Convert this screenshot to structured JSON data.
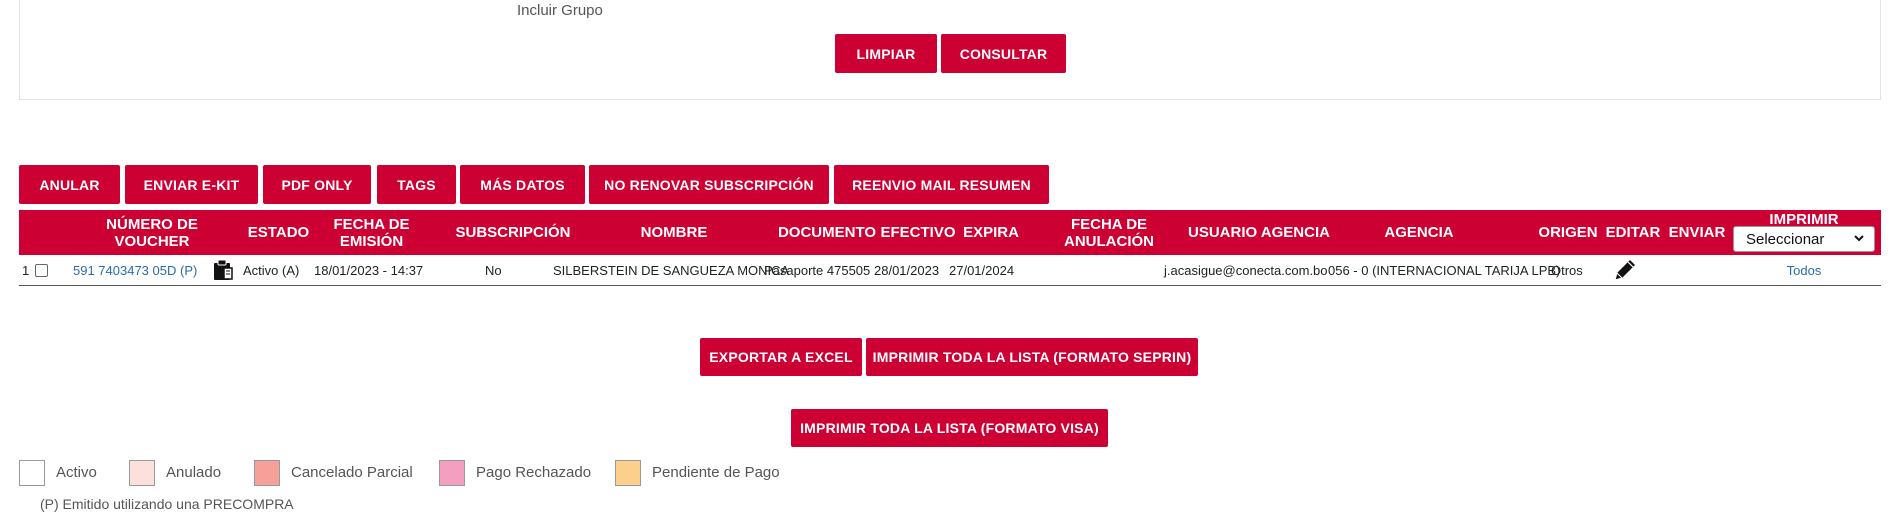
{
  "filter": {
    "include_group_label": "Incluir Grupo",
    "clear_label": "LIMPIAR",
    "search_label": "CONSULTAR"
  },
  "toolbar": {
    "anular": "ANULAR",
    "enviar_ekit": "ENVIAR E-KIT",
    "pdf_only": "PDF ONLY",
    "tags": "TAGS",
    "mas_datos": "MÁS DATOS",
    "no_renovar": "NO RENOVAR SUBSCRIPCIÓN",
    "reenvio_mail": "REENVIO MAIL RESUMEN"
  },
  "table": {
    "columns": {
      "voucher": "NÚMERO DE VOUCHER",
      "estado": "ESTADO",
      "fecha_emision": "FECHA DE EMISIÓN",
      "subscripcion": "SUBSCRIPCIÓN",
      "nombre": "NOMBRE",
      "documento": "DOCUMENTO",
      "efectivo": "EFECTIVO",
      "expira": "EXPIRA",
      "fecha_anulacion": "FECHA DE ANULACIÓN",
      "usuario_agencia": "USUARIO AGENCIA",
      "agencia": "AGENCIA",
      "origen": "ORIGEN",
      "editar": "EDITAR",
      "enviar": "ENVIAR",
      "imprimir": "IMPRIMIR"
    },
    "print_select_value": "Seleccionar",
    "rows": [
      {
        "index": "1",
        "voucher": "591 7403473 05D (P)",
        "estado": "Activo (A)",
        "fecha_emision": "18/01/2023 - 14:37",
        "subscripcion": "No",
        "nombre": "SILBERSTEIN DE SANGUEZA MONICA",
        "documento": "Pasaporte 475505",
        "efectivo": "28/01/2023",
        "expira": "27/01/2024",
        "fecha_anulacion": "",
        "usuario_agencia": "j.acasigue@conecta.com.bo",
        "agencia": "056 - 0 (INTERNACIONAL TARIJA LPB)",
        "origen": "Otros",
        "imprimir": "Todos"
      }
    ]
  },
  "export": {
    "excel": "EXPORTAR A EXCEL",
    "print_seprin": "IMPRIMIR TODA LA LISTA (FORMATO SEPRIN)",
    "print_visa": "IMPRIMIR TODA LA LISTA (FORMATO VISA)"
  },
  "legend": {
    "items": [
      {
        "label": "Activo",
        "color": "#ffffff"
      },
      {
        "label": "Anulado",
        "color": "#fde0dc"
      },
      {
        "label": "Cancelado Parcial",
        "color": "#f7a09a"
      },
      {
        "label": "Pago Rechazado",
        "color": "#f59fc0"
      },
      {
        "label": "Pendiente de Pago",
        "color": "#fcd08c"
      }
    ],
    "footnote": "(P) Emitido utilizando una PRECOMPRA"
  },
  "colors": {
    "accent": "#cc0033",
    "link": "#2b6cb0"
  }
}
